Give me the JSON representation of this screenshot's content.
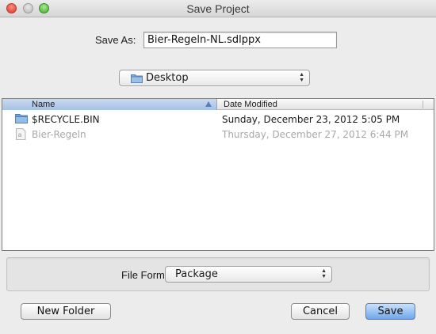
{
  "window": {
    "title": "Save Project"
  },
  "save_as": {
    "label": "Save As:",
    "value": "Bier-Regeln-NL.sdlppx"
  },
  "location": {
    "value": "Desktop",
    "icon": "folder-icon"
  },
  "browser": {
    "columns": {
      "name": "Name",
      "date_modified": "Date Modified"
    },
    "rows": [
      {
        "name": "$RECYCLE.BIN",
        "date": "Sunday, December 23, 2012 5:05 PM",
        "icon": "folder-icon",
        "enabled": true
      },
      {
        "name": "Bier-Regeln",
        "date": "Thursday, December 27, 2012 6:44 PM",
        "icon": "app-file-icon",
        "enabled": false
      }
    ]
  },
  "file_format": {
    "label": "File Format:",
    "value": "Package"
  },
  "buttons": {
    "new_folder": "New Folder",
    "cancel": "Cancel",
    "save": "Save"
  },
  "colors": {
    "accent": "#6fa7ec",
    "header_selected": "#a6c1e5",
    "disabled_text": "#a8a8a8"
  }
}
